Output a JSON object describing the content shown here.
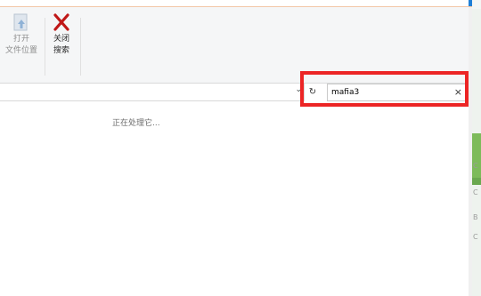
{
  "ribbon": {
    "open_location": {
      "line1": "打开",
      "line2": "文件位置"
    },
    "close_search": {
      "line1": "关闭",
      "line2": "搜索"
    }
  },
  "search": {
    "value": "mafia3",
    "clear": "×"
  },
  "address": {
    "chevron": "⌄",
    "refresh": "↻"
  },
  "status": {
    "text": "正在处理它..."
  },
  "right_edge": {
    "glyph1": "C",
    "glyph2": "C",
    "glyph3": "B",
    "glyph4": "C"
  },
  "colors": {
    "highlight": "#ec2525",
    "close_x": "#c01818",
    "accent": "#1f7fd6"
  }
}
